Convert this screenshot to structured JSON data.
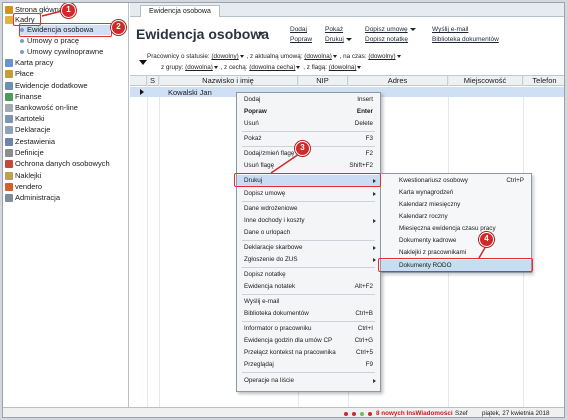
{
  "sidebar": {
    "items": [
      {
        "label": "Strona główna",
        "icon": "home-icon",
        "color": "#d98c2a"
      },
      {
        "label": "Kadry",
        "icon": "folder-icon",
        "color": "#e0b343"
      },
      {
        "label": "Karta pracy",
        "icon": "calendar-icon",
        "color": "#6c93c7"
      },
      {
        "label": "Płace",
        "icon": "coins-icon",
        "color": "#c79b3a"
      },
      {
        "label": "Ewidencje dodatkowe",
        "icon": "list-icon",
        "color": "#6d8fb5"
      },
      {
        "label": "Finanse",
        "icon": "money-icon",
        "color": "#4e9b5a"
      },
      {
        "label": "Bankowość on-line",
        "icon": "bank-icon",
        "color": "#a3a9b1"
      },
      {
        "label": "Kartoteki",
        "icon": "cards-icon",
        "color": "#7d94b3"
      },
      {
        "label": "Deklaracje",
        "icon": "document-icon",
        "color": "#8fa2bd"
      },
      {
        "label": "Zestawienia",
        "icon": "report-icon",
        "color": "#6b86a8"
      },
      {
        "label": "Definicje",
        "icon": "gear-icon",
        "color": "#8c8c8c"
      },
      {
        "label": "Ochrona danych osobowych",
        "icon": "shield-icon",
        "color": "#c24a3a"
      },
      {
        "label": "Naklejki",
        "icon": "sticker-icon",
        "color": "#b9a24e"
      },
      {
        "label": "vendero",
        "icon": "vendero-icon",
        "color": "#d2602a"
      },
      {
        "label": "Administracja",
        "icon": "admin-icon",
        "color": "#7f8c99"
      }
    ],
    "subitems": [
      {
        "label": "Ewidencja osobowa"
      },
      {
        "label": "Umowy o pracę"
      },
      {
        "label": "Umowy cywilnoprawne"
      }
    ]
  },
  "tabs": [
    {
      "label": "Ewidencja osobowa"
    }
  ],
  "header": {
    "title": "Ewidencja osobowa",
    "links": {
      "dodaj": "Dodaj",
      "popraw": "Popraw",
      "pokaz": "Pokaż",
      "drukuj": "Drukuj",
      "dopisz_umowe": "Dopisz umowę",
      "dopisz_notatke": "Dopisz notatkę",
      "wyslij": "Wyślij e-mail",
      "biblioteka": "Biblioteka dokumentów"
    }
  },
  "filters": {
    "line1_a": "Pracownicy o statusie:",
    "status_val": "(dowolny)",
    "line1_b": ", z aktualną umową:",
    "umowa_val": "(dowolna)",
    "line1_c": ", na czas:",
    "czas_val": "(dowolny)",
    "line2_a": "z grupy:",
    "grupa_val": "(dowolna)",
    "line2_b": ", z cechą:",
    "cecha_val": "(dowolna cecha)",
    "line2_c": ", z flagą:",
    "flaga_val": "(dowolna)"
  },
  "grid": {
    "columns": [
      "S",
      "Nazwisko i imię",
      "NIP",
      "Adres",
      "Miejscowość",
      "Telefon"
    ],
    "selected_row": "Kowalski Jan"
  },
  "context_menu": {
    "items": [
      {
        "label": "Dodaj",
        "shortcut": "Insert"
      },
      {
        "label": "Popraw",
        "shortcut": "Enter"
      },
      {
        "label": "Usuń",
        "shortcut": "Delete"
      },
      {
        "label": "Pokaż",
        "shortcut": "F3"
      },
      {
        "label": "Dodaj/zmień flagę",
        "shortcut": "F2"
      },
      {
        "label": "Usuń flagę",
        "shortcut": "Shift+F2"
      },
      {
        "label": "Drukuj",
        "shortcut": ""
      },
      {
        "label": "Dopisz umowę",
        "shortcut": ""
      },
      {
        "label": "Dane wdrożeniowe",
        "shortcut": ""
      },
      {
        "label": "Inne dochody i koszty",
        "shortcut": ""
      },
      {
        "label": "Dane o urlopach",
        "shortcut": ""
      },
      {
        "label": "Deklaracje skarbowe",
        "shortcut": ""
      },
      {
        "label": "Zgłoszenie do ZUS",
        "shortcut": ""
      },
      {
        "label": "Dopisz notatkę",
        "shortcut": ""
      },
      {
        "label": "Ewidencja notatek",
        "shortcut": "Alt+F2"
      },
      {
        "label": "Wyślij e-mail",
        "shortcut": ""
      },
      {
        "label": "Biblioteka dokumentów",
        "shortcut": "Ctrl+B"
      },
      {
        "label": "Informator o pracowniku",
        "shortcut": "Ctrl+I"
      },
      {
        "label": "Ewidencja godzin dla umów CP",
        "shortcut": "Ctrl+G"
      },
      {
        "label": "Przełącz kontekst na pracownika",
        "shortcut": "Ctrl+5"
      },
      {
        "label": "Przeglądaj",
        "shortcut": "F9"
      },
      {
        "label": "Operacje na liście",
        "shortcut": ""
      }
    ]
  },
  "submenu": {
    "items": [
      {
        "label": "Kwestionariusz osobowy",
        "shortcut": "Ctrl+P"
      },
      {
        "label": "Karta wynagrodzeń",
        "shortcut": ""
      },
      {
        "label": "Kalendarz miesięczny",
        "shortcut": ""
      },
      {
        "label": "Kalendarz roczny",
        "shortcut": ""
      },
      {
        "label": "Miesięczna ewidencja czasu pracy",
        "shortcut": ""
      },
      {
        "label": "Dokumenty kadrowe",
        "shortcut": ""
      },
      {
        "label": "Naklejki z pracownikami",
        "shortcut": ""
      },
      {
        "label": "Dokumenty RODO",
        "shortcut": ""
      }
    ]
  },
  "annotations": [
    "1",
    "2",
    "3",
    "4"
  ],
  "statusbar": {
    "message": "8 nowych InsWiadomości",
    "user": "Szef",
    "date": "piątek, 27 kwietnia 2018"
  },
  "colors": {
    "annotation_red": "#cf2a2a",
    "selection_blue": "#cfe0f5",
    "menu_highlight": "#c9dcf3"
  }
}
